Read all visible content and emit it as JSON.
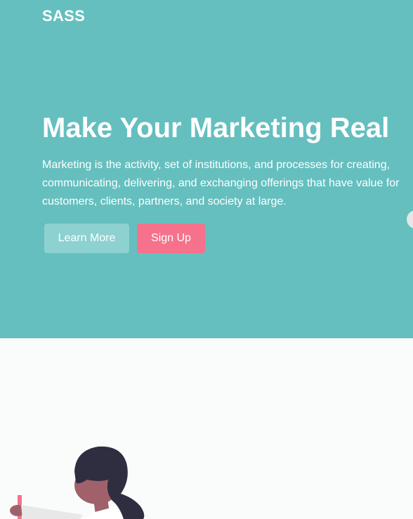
{
  "header": {
    "logo_text": "SASS"
  },
  "hero": {
    "title": "Make Your Marketing Real",
    "description": "Marketing is the activity, set of institutions, and processes for creating, communicating, delivering, and exchanging offerings that have value for customers, clients, partners, and society at large.",
    "learn_more_label": "Learn More",
    "sign_up_label": "Sign Up"
  },
  "colors": {
    "hero_background": "#65bfbf",
    "learn_more_button": "#8dd1d0",
    "sign_up_button": "#f6718b",
    "page_background": "#fafcfc"
  },
  "illustration": {
    "icon": "person-illustration"
  }
}
